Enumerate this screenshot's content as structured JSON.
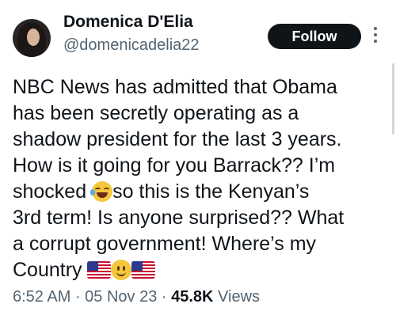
{
  "author": {
    "name": "Domenica D'Elia",
    "handle": "@domenicadelia22"
  },
  "follow_label": "Follow",
  "body": {
    "line1": "NBC News has admitted that Obama",
    "line2": "has been secretly operating as a",
    "line3": "shadow president for the last 3 years.",
    "line4": "How is it going for you Barrack?? I’m",
    "line5a": "shocked ",
    "line5b": "so this is the Kenyan’s",
    "line6": "3rd term! Is anyone surprised?? What",
    "line7": "a corrupt government! Where’s my",
    "line8": "Country "
  },
  "icons": {
    "more": "more-options-icon",
    "laugh": "face-with-tears-of-joy-emoji",
    "slight": "slightly-smiling-face-emoji",
    "flag": "us-flag-emoji"
  },
  "meta": {
    "time": "6:52 AM",
    "sep1": " · ",
    "date": "05 Nov 23",
    "sep2": " · ",
    "views_count": "45.8K",
    "views_label": " Views"
  },
  "colors": {
    "text": "#0f1419",
    "secondary": "#536471",
    "button_bg": "#0f1419",
    "button_text": "#ffffff"
  }
}
